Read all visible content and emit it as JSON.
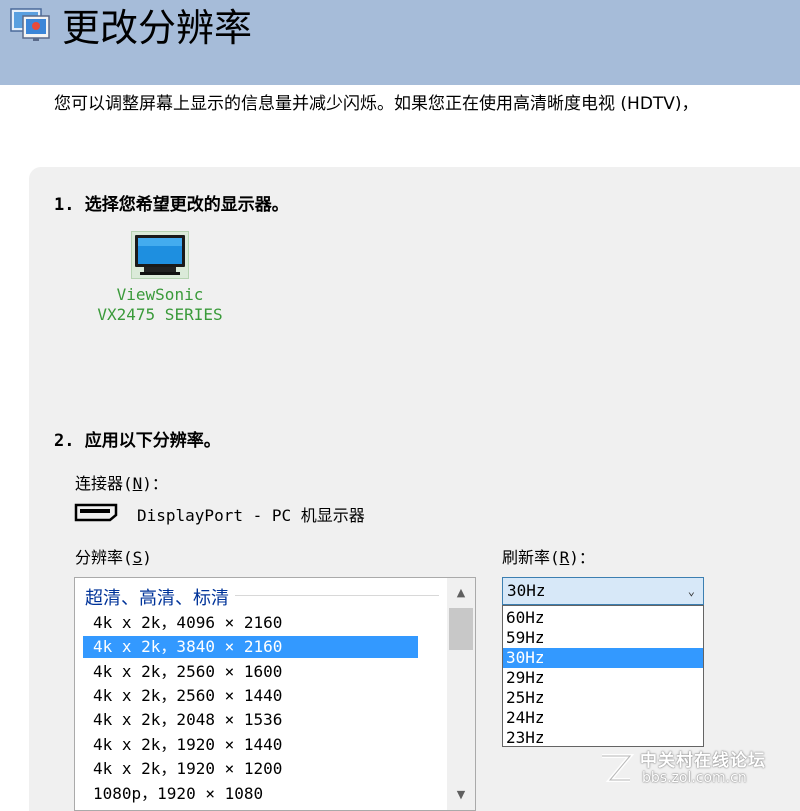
{
  "window": {
    "title": "更改分辨率",
    "description": "您可以调整屏幕上显示的信息量并减少闪烁。如果您正在使用高清晰度电视 (HDTV)，"
  },
  "step1": {
    "label": "1. 选择您希望更改的显示器。",
    "monitor": {
      "line1": "ViewSonic",
      "line2": "VX2475 SERIES"
    }
  },
  "step2": {
    "label": "2. 应用以下分辨率。",
    "connector": {
      "label_pre": "连接器(",
      "label_key": "N",
      "label_post": ")：",
      "value": "DisplayPort - PC 机显示器"
    },
    "resolution": {
      "label_pre": "分辨率(",
      "label_key": "S",
      "label_post": ")",
      "group": "超清、高清、标清",
      "items": [
        "4k x 2k，4096 × 2160",
        "4k x 2k，3840 × 2160",
        "4k x 2k，2560 × 1600",
        "4k x 2k，2560 × 1440",
        "4k x 2k，2048 × 1536",
        "4k x 2k，1920 × 1440",
        "4k x 2k，1920 × 1200",
        "1080p，1920 × 1080"
      ],
      "selected_index": 1
    },
    "refresh": {
      "label_pre": "刷新率(",
      "label_key": "R",
      "label_post": ")：",
      "current": "30Hz",
      "options": [
        "60Hz",
        "59Hz",
        "30Hz",
        "29Hz",
        "25Hz",
        "24Hz",
        "23Hz"
      ],
      "selected_index": 2
    }
  },
  "watermark": {
    "name": "中关村在线论坛",
    "url": "bbs.zol.com.cn"
  },
  "icons": {
    "title": "display-settings-icon",
    "monitor": "monitor-icon",
    "port": "displayport-icon",
    "scroll_up": "chevron-up-icon",
    "scroll_down": "chevron-down-icon",
    "dropdown": "chevron-down-icon"
  },
  "colors": {
    "header": "#a6bcd9",
    "panel": "#f0f0f0",
    "selection": "#3399ff",
    "group_text": "#003399",
    "monitor_text": "#3a9a3a"
  }
}
